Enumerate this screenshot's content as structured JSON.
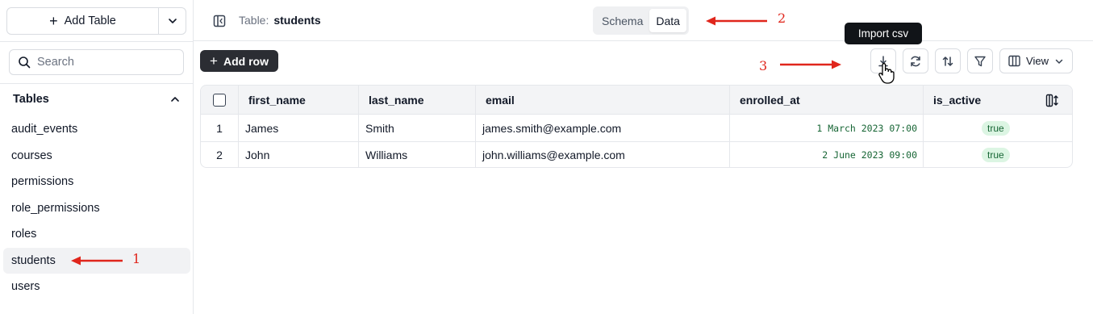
{
  "sidebar": {
    "add_table_label": "Add Table",
    "search_placeholder": "Search",
    "tables_heading": "Tables",
    "tables": [
      {
        "label": "audit_events"
      },
      {
        "label": "courses"
      },
      {
        "label": "permissions"
      },
      {
        "label": "role_permissions"
      },
      {
        "label": "roles"
      },
      {
        "label": "students"
      },
      {
        "label": "users"
      }
    ],
    "active_table": "students"
  },
  "header": {
    "table_label": "Table:",
    "table_name": "students",
    "tabs": [
      {
        "label": "Schema",
        "active": false
      },
      {
        "label": "Data",
        "active": true
      }
    ]
  },
  "toolbar": {
    "add_row_label": "Add row",
    "view_label": "View",
    "tooltip": "Import csv",
    "icons": [
      "import-csv-icon",
      "refresh-icon",
      "sort-icon",
      "filter-icon",
      "columns-icon"
    ]
  },
  "grid": {
    "columns": [
      "first_name",
      "last_name",
      "email",
      "enrolled_at",
      "is_active"
    ],
    "rows": [
      {
        "num": "1",
        "first_name": "James",
        "last_name": "Smith",
        "email": "james.smith@example.com",
        "enrolled_at": "1 March 2023 07:00",
        "is_active": "true"
      },
      {
        "num": "2",
        "first_name": "John",
        "last_name": "Williams",
        "email": "john.williams@example.com",
        "enrolled_at": "2 June 2023 09:00",
        "is_active": "true"
      }
    ]
  },
  "annotations": {
    "one": "1",
    "two": "2",
    "three": "3"
  },
  "colors": {
    "annotation_red": "#e0261c",
    "primary_button": "#2b2d33",
    "badge_bg": "#dcf5e3",
    "badge_text": "#166534"
  }
}
